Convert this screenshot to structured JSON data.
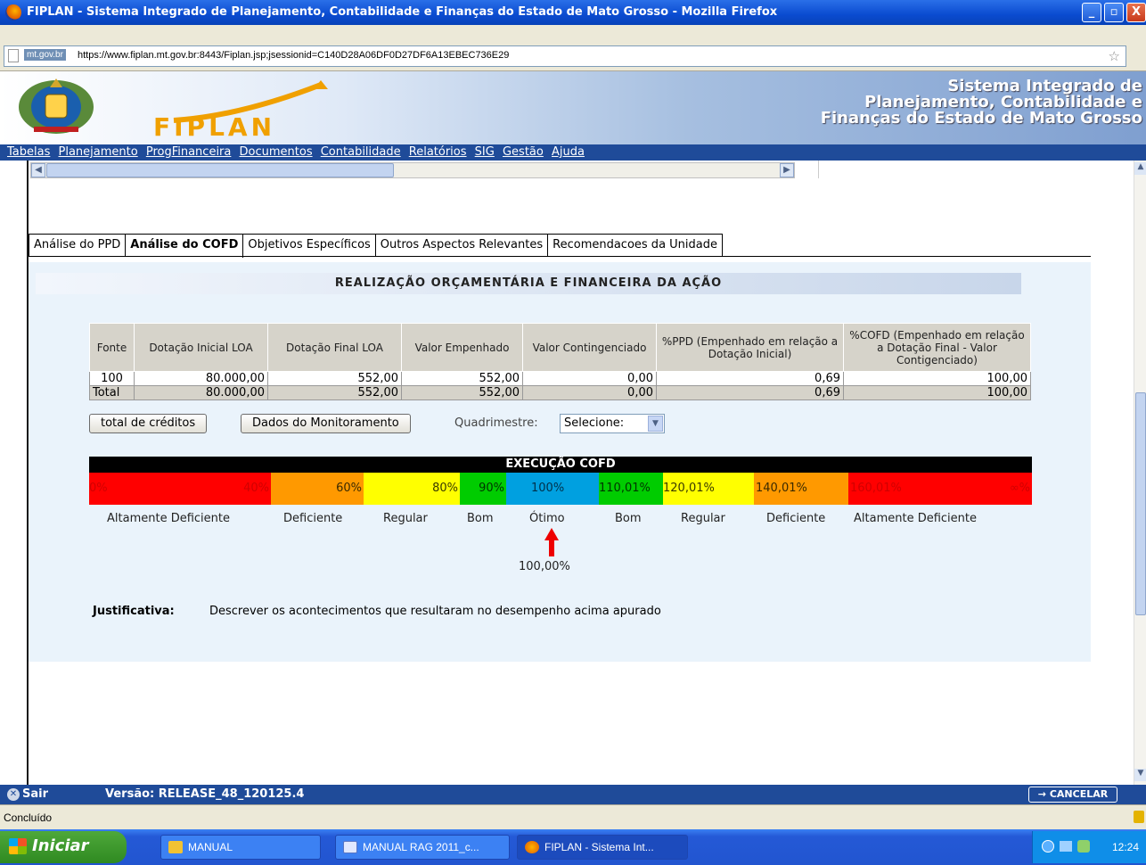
{
  "window": {
    "title": "FIPLAN - Sistema Integrado de Planejamento, Contabilidade e Finanças do Estado de Mato Grosso - Mozilla Firefox",
    "buttons": {
      "minimize": "_",
      "maximize": "▫",
      "close": "X"
    }
  },
  "address_bar": {
    "domain": "mt.gov.br",
    "url": "https://www.fiplan.mt.gov.br:8443/Fiplan.jsp;jsessionid=C140D28A06DF0D27DF6A13EBEC736E29"
  },
  "banner": {
    "logo_text": "FIPLAN",
    "title_lines": [
      "Sistema Integrado de",
      "Planejamento, Contabilidade e",
      "Finanças do Estado de Mato Grosso"
    ]
  },
  "menu": [
    "Tabelas",
    "Planejamento",
    "ProgFinanceira",
    "Documentos",
    "Contabilidade",
    "Relatórios",
    "SIG",
    "Gestão",
    "Ajuda"
  ],
  "tabs": [
    {
      "label": "Análise do PPD",
      "active": false
    },
    {
      "label": "Análise do COFD",
      "active": true
    },
    {
      "label": "Objetivos Específicos",
      "active": false
    },
    {
      "label": "Outros Aspectos Relevantes",
      "active": false
    },
    {
      "label": "Recomendacoes da Unidade",
      "active": false
    }
  ],
  "section_title": "REALIZAÇÃO ORÇAMENTÁRIA E FINANCEIRA DA AÇÃO",
  "table": {
    "headers": [
      "Fonte",
      "Dotação Inicial LOA",
      "Dotação Final LOA",
      "Valor Empenhado",
      "Valor Contingenciado",
      "%PPD (Empenhado em relação a Dotação Inicial)",
      "%COFD (Empenhado em relação a Dotação Final - Valor Contigenciado)"
    ],
    "rows": [
      [
        "100",
        "80.000,00",
        "552,00",
        "552,00",
        "0,00",
        "0,69",
        "100,00"
      ]
    ],
    "total": [
      "Total",
      "80.000,00",
      "552,00",
      "552,00",
      "0,00",
      "0,69",
      "100,00"
    ]
  },
  "actions": {
    "creditos_label": "total de créditos",
    "monitoramento_label": "Dados do Monitoramento",
    "quadrimestre_label": "Quadrimestre:",
    "quadrimestre_value": "Selecione:"
  },
  "scale": {
    "title": "EXECUÇÃO COFD",
    "segments": [
      {
        "text_left": "0%",
        "text_right": "40%",
        "color": "#ff0000",
        "text_color": "#d00000"
      },
      {
        "text_left": "",
        "text_right": "60%",
        "color": "#ff9900",
        "text_color": "#3a2a00"
      },
      {
        "text_left": "",
        "text_right": "80%",
        "color": "#ffff00",
        "text_color": "#3a3a00"
      },
      {
        "text_left": "",
        "text_right": "90%",
        "color": "#00cc00",
        "text_color": "#003300"
      },
      {
        "text_left": "",
        "text_right": "100%",
        "color": "#00a0e0",
        "text_color": "#00304a"
      },
      {
        "text_left": "110,01%",
        "text_right": "",
        "color": "#00cc00",
        "text_color": "#003300"
      },
      {
        "text_left": "120,01%",
        "text_right": "",
        "color": "#ffff00",
        "text_color": "#3a3a00"
      },
      {
        "text_left": "140,01%",
        "text_right": "",
        "color": "#ff9900",
        "text_color": "#3a2a00"
      },
      {
        "text_left": "160,01%",
        "text_right": "∞%",
        "color": "#ff0000",
        "text_color": "#d00000"
      }
    ],
    "labels": [
      "Altamente Deficiente",
      "Deficiente",
      "Regular",
      "Bom",
      "Ótimo",
      "Bom",
      "Regular",
      "Deficiente",
      "Altamente Deficiente"
    ],
    "pointer_value": "100,00%",
    "pointer_color": "#ee0000"
  },
  "justificativa": {
    "label": "Justificativa:",
    "text": "Descrever os acontecimentos que resultaram no desempenho acima apurado"
  },
  "app_footer": {
    "sair": "Sair",
    "versao": "Versão: RELEASE_48_120125.4",
    "cancelar": "→ CANCELAR"
  },
  "status": "Concluído",
  "taskbar": {
    "start": "Iniciar",
    "tasks": [
      "MANUAL",
      "MANUAL RAG 2011_c...",
      "FIPLAN - Sistema Int..."
    ],
    "clock": "12:24"
  },
  "colors": {
    "menu_bg": "#1f4b99",
    "panel_bg": "#eaf3fb"
  }
}
